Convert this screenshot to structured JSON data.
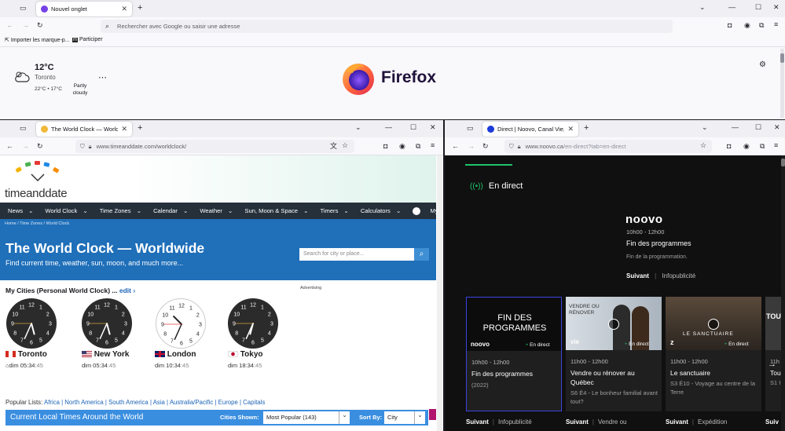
{
  "top_window": {
    "tab_title": "Nouvel onglet",
    "url_placeholder": "Rechercher avec Google ou saisir une adresse",
    "bookmarks": [
      "Importer les marque-p...",
      "Participer"
    ],
    "weather": {
      "temp": "12°C",
      "city": "Toronto",
      "range": "22°C • 17°C",
      "condition": "Partly cloudy"
    },
    "brand": "Firefox"
  },
  "left_window": {
    "tab_title": "The World Clock — Worldwide",
    "url": "www.timeanddate.com/worldclock/",
    "logo": "timeanddate",
    "menu": [
      "News",
      "World Clock",
      "Time Zones",
      "Calendar",
      "Weather",
      "Sun, Moon & Space",
      "Timers",
      "Calculators",
      "My Account"
    ],
    "breadcrumb": [
      "Home",
      "Time Zones",
      "World Clock"
    ],
    "hero_title": "The World Clock — Worldwide",
    "hero_subtitle": "Find current time, weather, sun, moon, and much more...",
    "search_placeholder": "Search for city or place...",
    "my_cities_label": "My Cities (Personal World Clock) ...",
    "edit_label": "edit",
    "advertising": "Advertising",
    "cities": [
      {
        "name": "Toronto",
        "time_prefix": "dim 05:34",
        "time_sec": ":45"
      },
      {
        "name": "New York",
        "time_prefix": "dim 05:34",
        "time_sec": ":45"
      },
      {
        "name": "London",
        "time_prefix": "dim 10:34",
        "time_sec": ":45"
      },
      {
        "name": "Tokyo",
        "time_prefix": "dim 18:34",
        "time_sec": ":45"
      }
    ],
    "popular_label": "Popular Lists:",
    "popular_links": [
      "Africa",
      "North America",
      "South America",
      "Asia",
      "Australia/Pacific",
      "Europe",
      "Capitals"
    ],
    "current_bar": {
      "title": "Current Local Times Around the World",
      "cities_shown_label": "Cities Shown:",
      "cities_shown_value": "Most Popular (143)",
      "sort_label": "Sort By:",
      "sort_value": "City"
    }
  },
  "right_window": {
    "tab_title": "Direct | Noovo, Canal Vie, Canal",
    "url_host": "www.noovo.ca",
    "url_path": "/en-direct?tab=en-direct",
    "live_label": "En direct",
    "channel_logo": "noovo",
    "now_time": "10h00 - 12h00",
    "now_title": "Fin des programmes",
    "now_desc": "Fin de la programmation.",
    "links": [
      "Suivant",
      "Infopublicité"
    ],
    "cards": [
      {
        "img_text": "FIN DES PROGRAMMES",
        "logo": "noovo",
        "badge": "En direct",
        "time": "10h00 - 12h00",
        "title": "Fin des programmes",
        "desc": "(2022)"
      },
      {
        "img_text": "VENDRE OU RÉNOVER",
        "logo": "vie",
        "badge": "En direct",
        "time": "11h00 - 12h00",
        "title": "Vendre ou rénover au Québec",
        "desc": "S6 É4 - Le bonheur familial avant tout?"
      },
      {
        "img_text": "LE SANCTUAIRE",
        "logo": "z",
        "badge": "En direct",
        "time": "11h00 - 12h00",
        "title": "Le sanctuaire",
        "desc": "S3 É10 - Voyage au centre de la Terre"
      },
      {
        "img_text": "TOUT",
        "time": "11h",
        "title": "Tou",
        "desc": "S1 I Bail"
      }
    ],
    "bottom_links": [
      [
        "Suivant",
        "Infopublicité"
      ],
      [
        "Suivant",
        "Vendre ou"
      ],
      [
        "Suivant",
        "Expédition"
      ],
      [
        "Suiv"
      ]
    ]
  }
}
